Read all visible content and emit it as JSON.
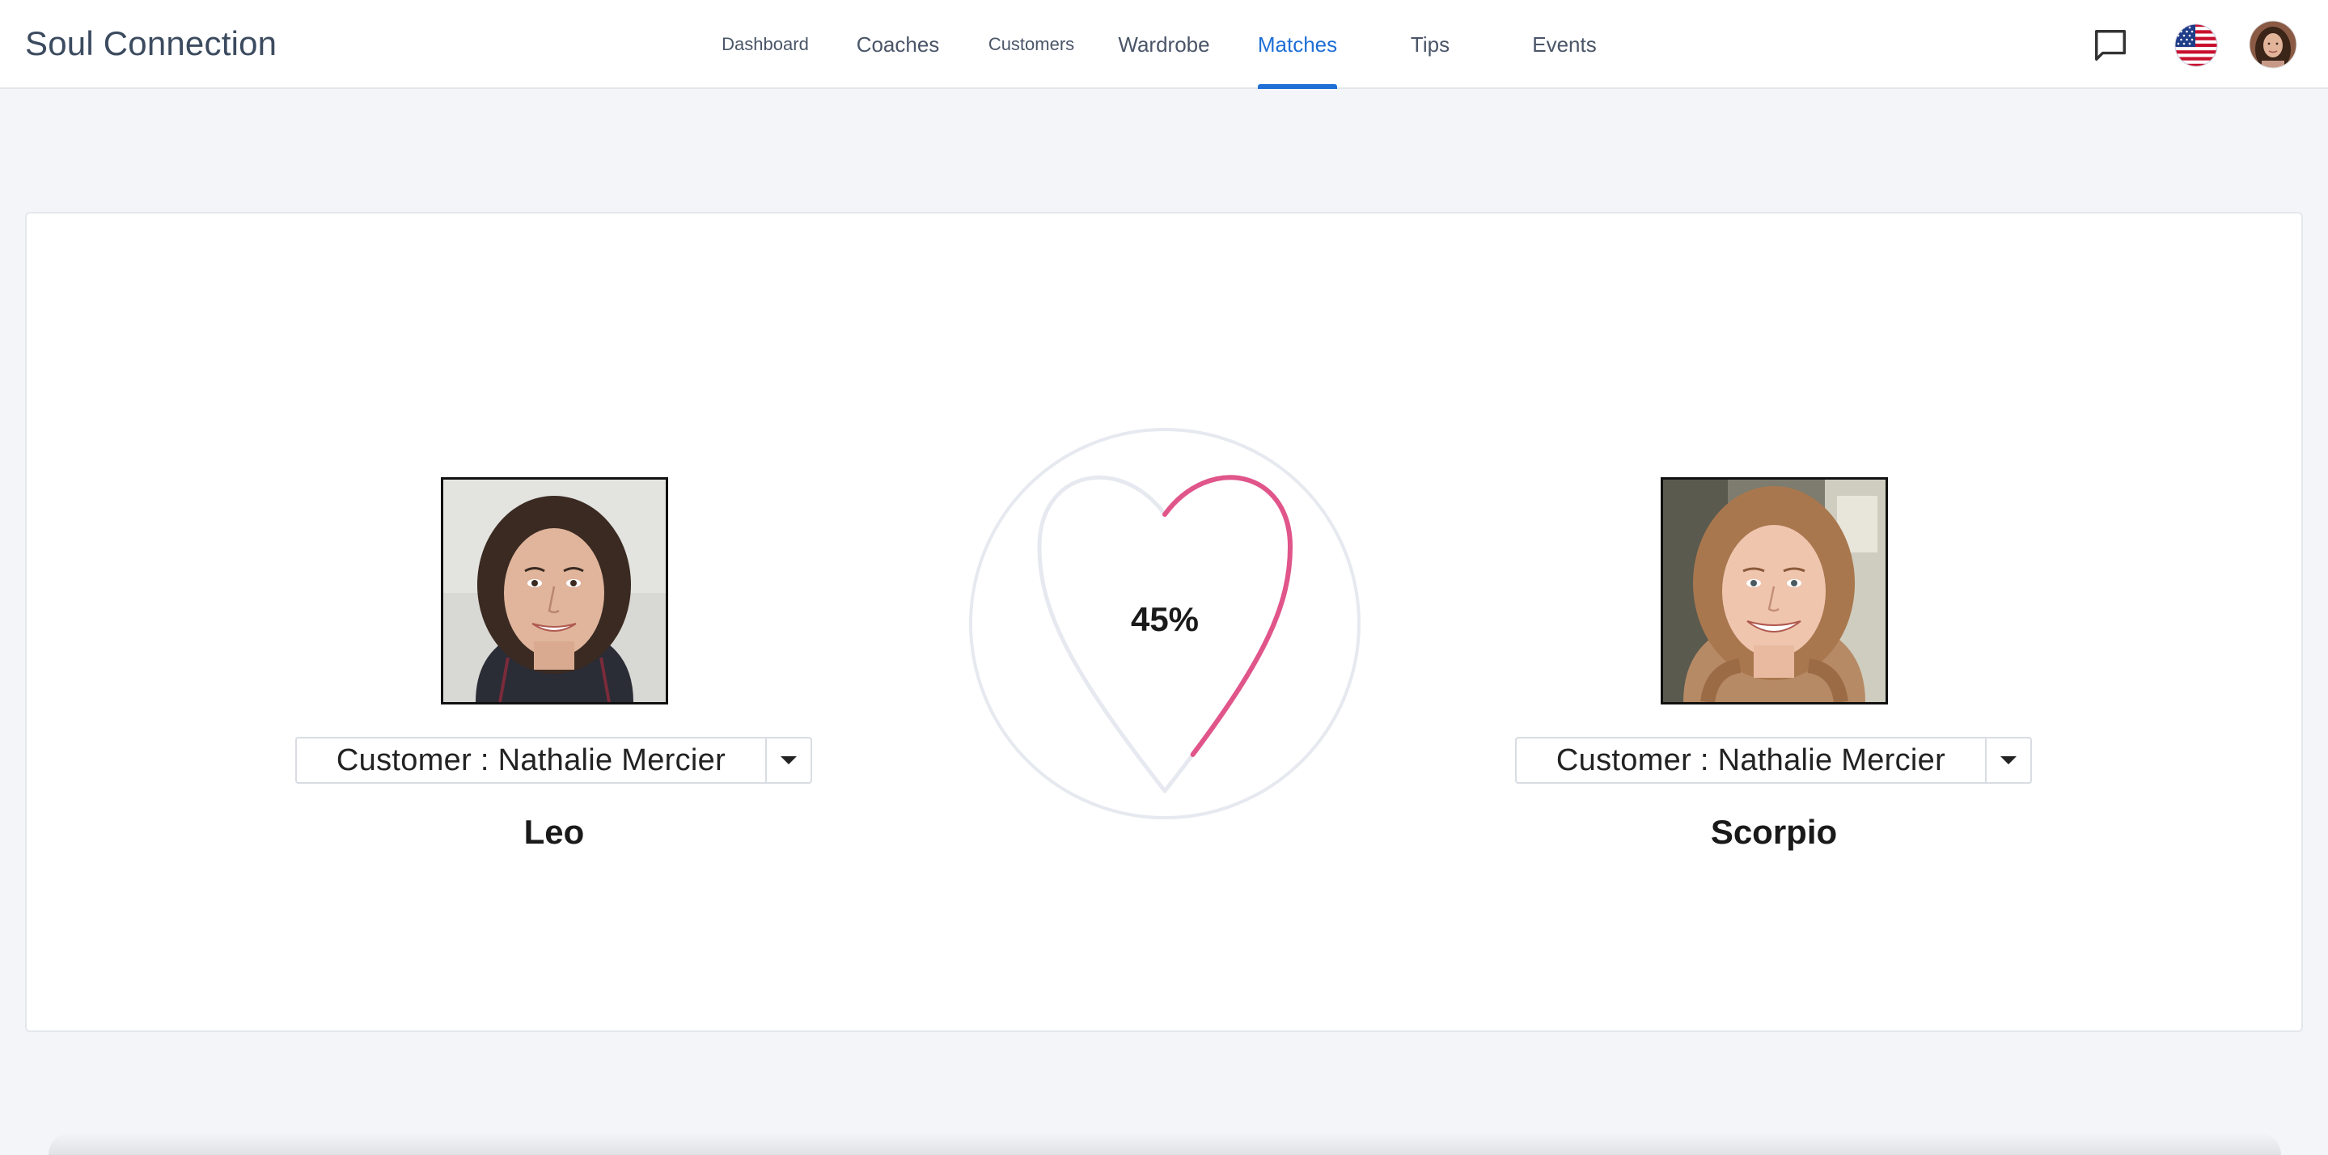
{
  "header": {
    "brand": "Soul Connection",
    "nav": [
      {
        "label": "Dashboard"
      },
      {
        "label": "Coaches"
      },
      {
        "label": "Customers"
      },
      {
        "label": "Wardrobe"
      },
      {
        "label": "Matches"
      },
      {
        "label": "Tips"
      },
      {
        "label": "Events"
      }
    ],
    "active_tab": "Matches",
    "icons": [
      "chat-icon",
      "us-flag-icon",
      "user-avatar"
    ]
  },
  "match": {
    "left": {
      "selector_label": "Customer : Nathalie Mercier",
      "sign": "Leo"
    },
    "right": {
      "selector_label": "Customer : Nathalie Mercier",
      "sign": "Scorpio"
    },
    "compatibility": {
      "label": "45%",
      "value": 0.45
    }
  },
  "colors": {
    "accent": "#1f6fd6",
    "heart": "#e0558a",
    "track": "#e6e9ef"
  }
}
